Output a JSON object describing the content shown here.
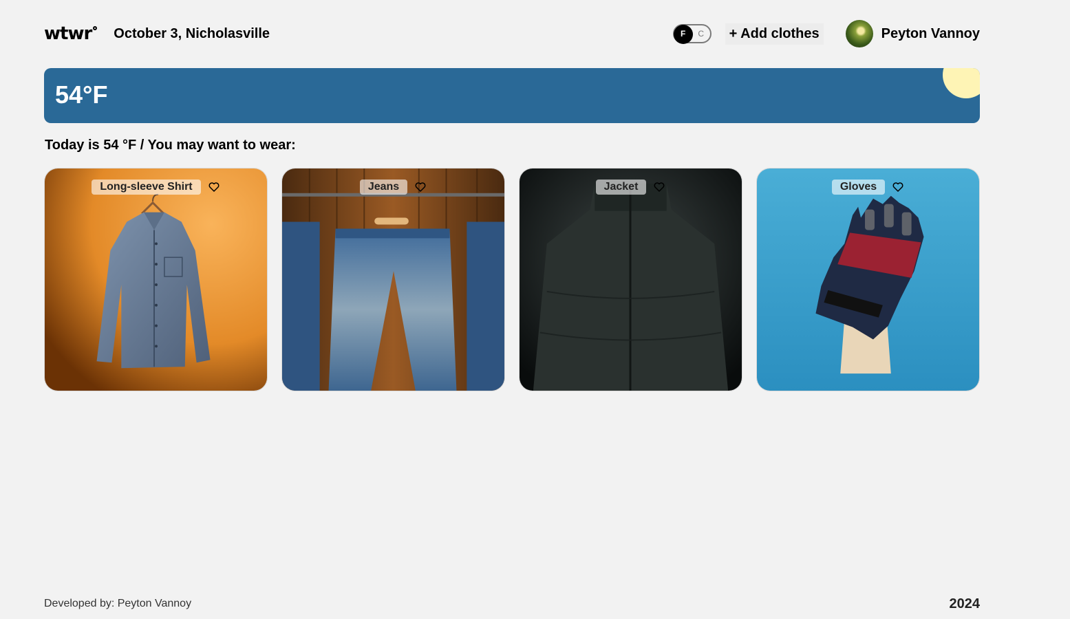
{
  "header": {
    "logo": "wtwr",
    "date_location": "October 3, Nicholasville",
    "toggle": {
      "f_label": "F",
      "c_label": "C",
      "selected": "F"
    },
    "add_clothes_label": "+ Add clothes",
    "username": "Peyton Vannoy"
  },
  "weather": {
    "temperature": "54°F"
  },
  "suggestion_text": "Today is 54 °F / You may want to wear:",
  "cards": [
    {
      "name": "Long-sleeve Shirt"
    },
    {
      "name": "Jeans"
    },
    {
      "name": "Jacket"
    },
    {
      "name": "Gloves"
    }
  ],
  "footer": {
    "developed_by": "Developed by: Peyton Vannoy",
    "year": "2024"
  }
}
